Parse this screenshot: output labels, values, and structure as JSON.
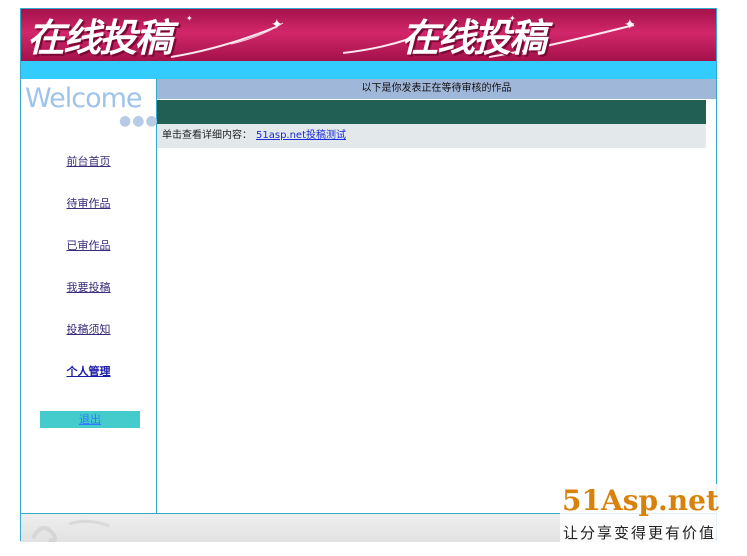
{
  "banner": {
    "title_left": "在线投稿",
    "title_right": "在线投稿"
  },
  "sidebar": {
    "welcome": "Welcome",
    "dots": "●●●",
    "items": [
      {
        "label": "前台首页",
        "strong": false
      },
      {
        "label": "待审作品",
        "strong": false
      },
      {
        "label": "已审作品",
        "strong": false
      },
      {
        "label": "我要投稿",
        "strong": false
      },
      {
        "label": "投稿须知",
        "strong": false
      },
      {
        "label": "个人管理",
        "strong": true
      }
    ],
    "logout": "退出"
  },
  "main": {
    "header": "以下是你发表正在等待审核的作品",
    "detail_label": "单击查看详细内容：",
    "detail_link": "51asp.net投稿测试"
  },
  "watermark": {
    "brand": "51Asp.net",
    "slogan": "让分享变得更有价值"
  },
  "colors": {
    "banner": "#c41a5c",
    "cyan": "#33ccff",
    "header": "#9fb7d9",
    "dark_band": "#215f54",
    "logout_bg": "#44cccc",
    "watermark": "#d8820c"
  }
}
